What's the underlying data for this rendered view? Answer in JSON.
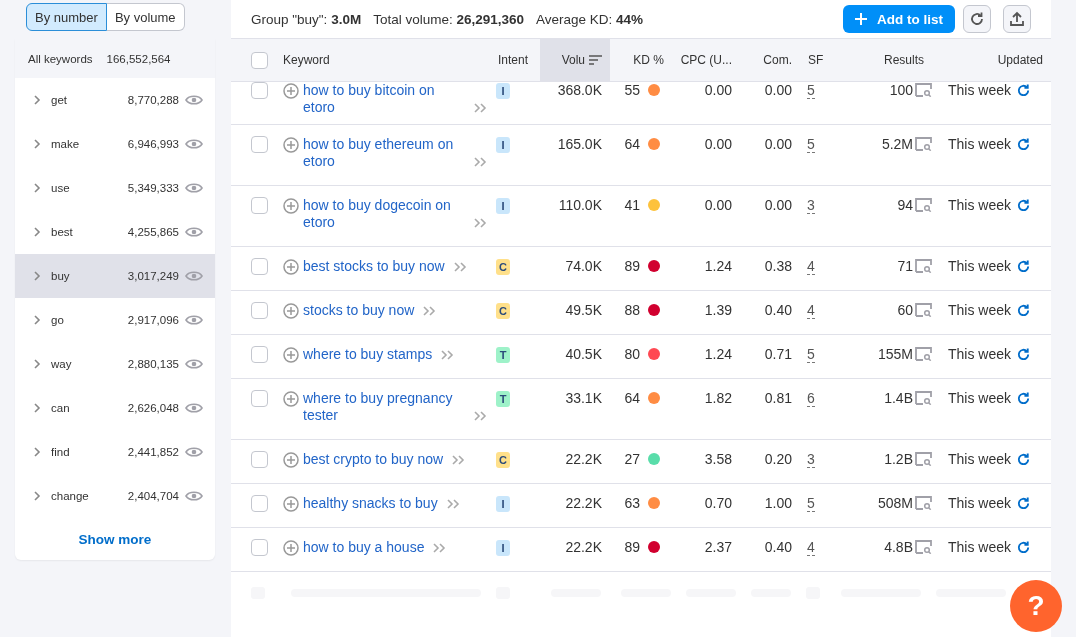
{
  "sidebar": {
    "toggle": [
      {
        "label": "By number",
        "selected": true
      },
      {
        "label": "By volume",
        "selected": false
      }
    ],
    "all": {
      "label": "All keywords",
      "count": "166,552,564"
    },
    "items": [
      {
        "label": "get",
        "count": "8,770,288",
        "selected": false
      },
      {
        "label": "make",
        "count": "6,946,993",
        "selected": false
      },
      {
        "label": "use",
        "count": "5,349,333",
        "selected": false
      },
      {
        "label": "best",
        "count": "4,255,865",
        "selected": false
      },
      {
        "label": "buy",
        "count": "3,017,249",
        "selected": true
      },
      {
        "label": "go",
        "count": "2,917,096",
        "selected": false
      },
      {
        "label": "way",
        "count": "2,880,135",
        "selected": false
      },
      {
        "label": "can",
        "count": "2,626,048",
        "selected": false
      },
      {
        "label": "find",
        "count": "2,441,852",
        "selected": false
      },
      {
        "label": "change",
        "count": "2,404,704",
        "selected": false
      }
    ],
    "show_more": "Show more"
  },
  "summary": [
    {
      "label": "Group \"buy\":",
      "value": "3.0M"
    },
    {
      "label": "Total volume:",
      "value": "26,291,360"
    },
    {
      "label": "Average KD:",
      "value": "44%"
    }
  ],
  "add_button": "Add to list",
  "table": {
    "select_all_checked": false,
    "columns": [
      {
        "label": "Keyword",
        "sorted": false
      },
      {
        "label": "Intent",
        "sorted": false
      },
      {
        "label": "Volu",
        "sorted": true
      },
      {
        "label": "KD %",
        "sorted": false
      },
      {
        "label": "CPC (U...",
        "sorted": false
      },
      {
        "label": "Com.",
        "sorted": false
      },
      {
        "label": "SF",
        "sorted": false
      },
      {
        "label": "Results",
        "sorted": false
      },
      {
        "label": "Updated",
        "sorted": false
      }
    ],
    "rows": [
      {
        "checked": false,
        "keyword": "how to buy bitcoin on etoro",
        "intent": {
          "label": "I",
          "color": "#c9e6fb"
        },
        "volume": "368.0K",
        "kd": {
          "value": "55",
          "color": "#ff8c43"
        },
        "cpc": "0.00",
        "com": "0.00",
        "sf": "5",
        "results": "100",
        "updated": "This week"
      },
      {
        "checked": false,
        "keyword": "how to buy ethereum on etoro",
        "intent": {
          "label": "I",
          "color": "#c9e6fb"
        },
        "volume": "165.0K",
        "kd": {
          "value": "64",
          "color": "#ff8c43"
        },
        "cpc": "0.00",
        "com": "0.00",
        "sf": "5",
        "results": "5.2M",
        "updated": "This week"
      },
      {
        "checked": false,
        "keyword": "how to buy dogecoin on etoro",
        "intent": {
          "label": "I",
          "color": "#c9e6fb"
        },
        "volume": "110.0K",
        "kd": {
          "value": "41",
          "color": "#fdc23c"
        },
        "cpc": "0.00",
        "com": "0.00",
        "sf": "3",
        "results": "94",
        "updated": "This week"
      },
      {
        "checked": false,
        "keyword": "best stocks to buy now",
        "intent": {
          "label": "C",
          "color": "#ffe08a"
        },
        "volume": "74.0K",
        "kd": {
          "value": "89",
          "color": "#d1002f"
        },
        "cpc": "1.24",
        "com": "0.38",
        "sf": "4",
        "results": "71",
        "updated": "This week"
      },
      {
        "checked": false,
        "keyword": "stocks to buy now",
        "intent": {
          "label": "C",
          "color": "#ffe08a"
        },
        "volume": "49.5K",
        "kd": {
          "value": "88",
          "color": "#d1002f"
        },
        "cpc": "1.39",
        "com": "0.40",
        "sf": "4",
        "results": "60",
        "updated": "This week"
      },
      {
        "checked": false,
        "keyword": "where to buy stamps",
        "intent": {
          "label": "T",
          "color": "#9ef2c9"
        },
        "volume": "40.5K",
        "kd": {
          "value": "80",
          "color": "#ff4953"
        },
        "cpc": "1.24",
        "com": "0.71",
        "sf": "5",
        "results": "155M",
        "updated": "This week"
      },
      {
        "checked": false,
        "keyword": "where to buy pregnancy tester",
        "intent": {
          "label": "T",
          "color": "#9ef2c9"
        },
        "volume": "33.1K",
        "kd": {
          "value": "64",
          "color": "#ff8c43"
        },
        "cpc": "1.82",
        "com": "0.81",
        "sf": "6",
        "results": "1.4B",
        "updated": "This week"
      },
      {
        "checked": false,
        "keyword": "best crypto to buy now",
        "intent": {
          "label": "C",
          "color": "#ffe08a"
        },
        "volume": "22.2K",
        "kd": {
          "value": "27",
          "color": "#59ddaa"
        },
        "cpc": "3.58",
        "com": "0.20",
        "sf": "3",
        "results": "1.2B",
        "updated": "This week"
      },
      {
        "checked": false,
        "keyword": "healthy snacks to buy",
        "intent": {
          "label": "I",
          "color": "#c9e6fb"
        },
        "volume": "22.2K",
        "kd": {
          "value": "63",
          "color": "#ff8c43"
        },
        "cpc": "0.70",
        "com": "1.00",
        "sf": "5",
        "results": "508M",
        "updated": "This week"
      },
      {
        "checked": false,
        "keyword": "how to buy a house",
        "intent": {
          "label": "I",
          "color": "#c9e6fb"
        },
        "volume": "22.2K",
        "kd": {
          "value": "89",
          "color": "#d1002f"
        },
        "cpc": "2.37",
        "com": "0.40",
        "sf": "4",
        "results": "4.8B",
        "updated": "This week"
      }
    ]
  },
  "help_button": "?"
}
